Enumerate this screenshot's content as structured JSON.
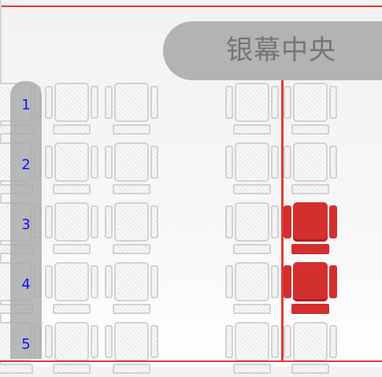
{
  "screen": {
    "label": "银幕中央"
  },
  "row_numbers": [
    "1",
    "2",
    "3",
    "4",
    "5"
  ],
  "seat_map": {
    "rows": 5,
    "visible_columns": 6,
    "selected": [
      {
        "row": 3,
        "column": 5
      },
      {
        "row": 4,
        "column": 5
      }
    ]
  },
  "colors": {
    "selected_seat": "#d32f2f",
    "available_seat_outline": "#d2d2d2",
    "center_line": "#e53935",
    "row_number_text": "#1010ff",
    "screen_label_bg": "#b3b3b3"
  }
}
